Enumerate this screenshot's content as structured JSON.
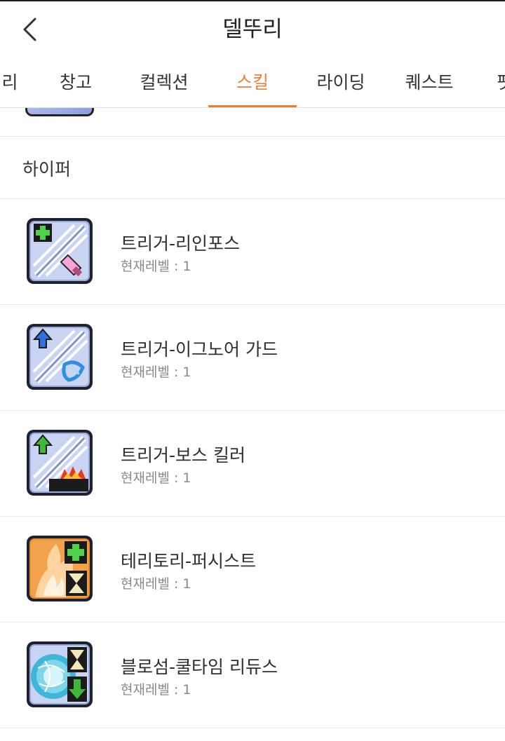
{
  "header": {
    "title": "델뚜리"
  },
  "tabs": [
    {
      "label": "리",
      "active": false
    },
    {
      "label": "창고",
      "active": false
    },
    {
      "label": "컬렉션",
      "active": false
    },
    {
      "label": "스킬",
      "active": true
    },
    {
      "label": "라이딩",
      "active": false
    },
    {
      "label": "퀘스트",
      "active": false
    },
    {
      "label": "펫",
      "active": false
    }
  ],
  "colors": {
    "accent": "#ef7f35"
  },
  "section": {
    "title": "하이퍼"
  },
  "skills": [
    {
      "name": "트리거-리인포스",
      "level": "현재레벨 : 1",
      "icon": "trigger-reinforce-icon"
    },
    {
      "name": "트리거-이그노어 가드",
      "level": "현재레벨 : 1",
      "icon": "trigger-ignore-guard-icon"
    },
    {
      "name": "트리거-보스 킬러",
      "level": "현재레벨 : 1",
      "icon": "trigger-boss-killer-icon"
    },
    {
      "name": "테리토리-퍼시스트",
      "level": "현재레벨 : 1",
      "icon": "territory-persist-icon"
    },
    {
      "name": "블로섬-쿨타임 리듀스",
      "level": "현재레벨 : 1",
      "icon": "blossom-cooltime-reduce-icon"
    }
  ]
}
